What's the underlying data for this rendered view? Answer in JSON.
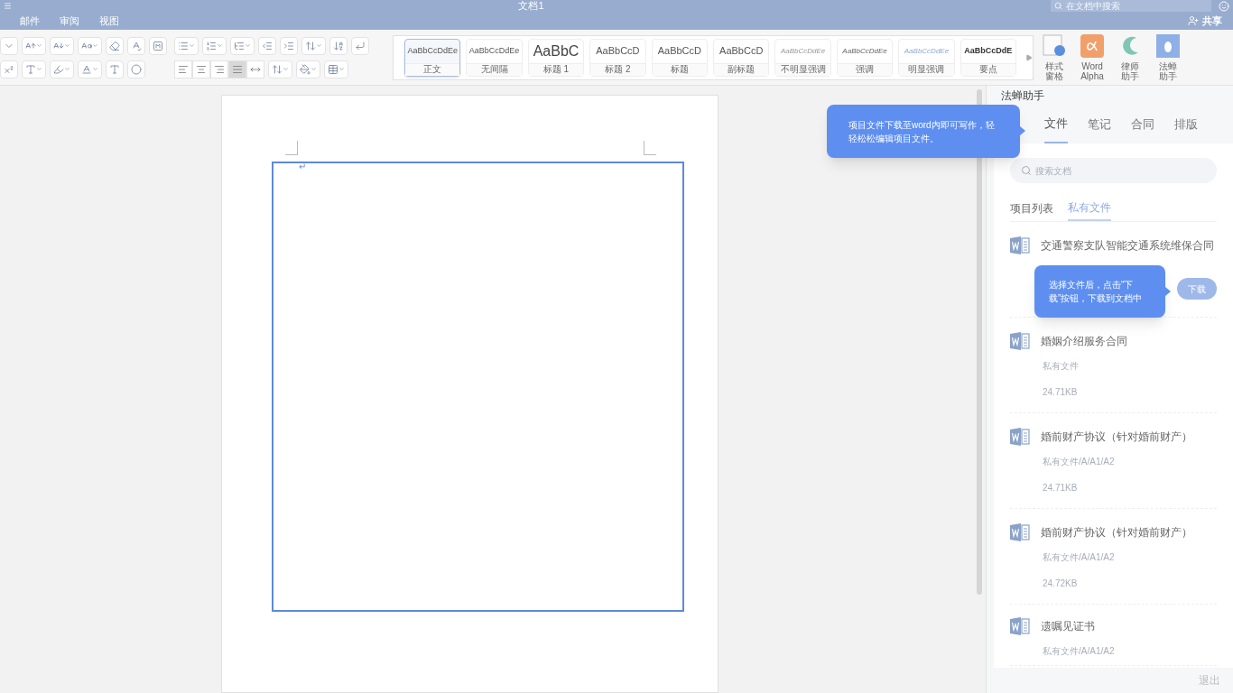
{
  "window": {
    "title": "文档1",
    "search": {
      "placeholder": "在文档中搜索"
    },
    "share": "共享"
  },
  "menu": [
    {
      "label": "邮件"
    },
    {
      "label": "审阅"
    },
    {
      "label": "视图"
    }
  ],
  "ribbon": {
    "alignments": [
      {
        "selected": false
      },
      {
        "selected": false
      },
      {
        "selected": false
      },
      {
        "selected": true
      },
      {
        "selected": false
      }
    ],
    "styles": [
      {
        "sample": "AaBbCcDdEe",
        "label": "正文",
        "kind": "normal",
        "selected": true
      },
      {
        "sample": "AaBbCcDdEe",
        "label": "无间隔",
        "kind": "normal",
        "selected": false
      },
      {
        "sample": "AaBbC",
        "label": "标题 1",
        "kind": "heading1",
        "selected": false
      },
      {
        "sample": "AaBbCcD",
        "label": "标题 2",
        "kind": "heading2",
        "selected": false
      },
      {
        "sample": "AaBbCcD",
        "label": "标题",
        "kind": "heading2",
        "selected": false
      },
      {
        "sample": "AaBbCcD",
        "label": "副标题",
        "kind": "heading2",
        "selected": false
      },
      {
        "sample": "AaBbCcDdEe",
        "label": "不明显强调",
        "kind": "subtle",
        "selected": false
      },
      {
        "sample": "AaBbCcDdEe",
        "label": "强调",
        "kind": "emphasis",
        "selected": false
      },
      {
        "sample": "AaBbCcDdEe",
        "label": "明显强调",
        "kind": "intense",
        "selected": false
      },
      {
        "sample": "AaBbCcDdE",
        "label": "要点",
        "kind": "strong",
        "selected": false
      }
    ],
    "tools": [
      {
        "label": "样式窗格",
        "kind": "pane"
      },
      {
        "label": "Word Alpha",
        "kind": "alpha"
      },
      {
        "label": "律师助手",
        "kind": "lawyer"
      },
      {
        "label": "法蝉助手",
        "kind": "cicada"
      }
    ]
  },
  "document": {
    "paragraph_mark": "↵"
  },
  "panel": {
    "title": "法蝉助手",
    "tabs": [
      {
        "label": "文件",
        "selected": true
      },
      {
        "label": "笔记",
        "selected": false
      },
      {
        "label": "合同",
        "selected": false
      },
      {
        "label": "排版",
        "selected": false
      }
    ],
    "search": {
      "placeholder": "搜索文档"
    },
    "subtabs": [
      {
        "label": "项目列表",
        "selected": false
      },
      {
        "label": "私有文件",
        "selected": true
      }
    ],
    "files": [
      {
        "name": "交通警察支队智能交通系统维保合同",
        "download": "下载"
      },
      {
        "name": "婚姻介绍服务合同",
        "path": "私有文件",
        "size": "24.71KB"
      },
      {
        "name": "婚前财产协议（针对婚前财产）",
        "path": "私有文件/A/A1/A2",
        "size": "24.71KB"
      },
      {
        "name": "婚前财产协议（针对婚前财产）",
        "path": "私有文件/A/A1/A2",
        "size": "24.72KB"
      },
      {
        "name": "遗嘱见证书",
        "path": "私有文件/A/A1/A2"
      }
    ],
    "exit": "退出"
  },
  "tips": [
    {
      "text": "项目文件下载至word内即可写作，轻轻松松编辑项目文件。"
    },
    {
      "text": "选择文件后，点击“下载”按钮，下载到文档中"
    }
  ]
}
